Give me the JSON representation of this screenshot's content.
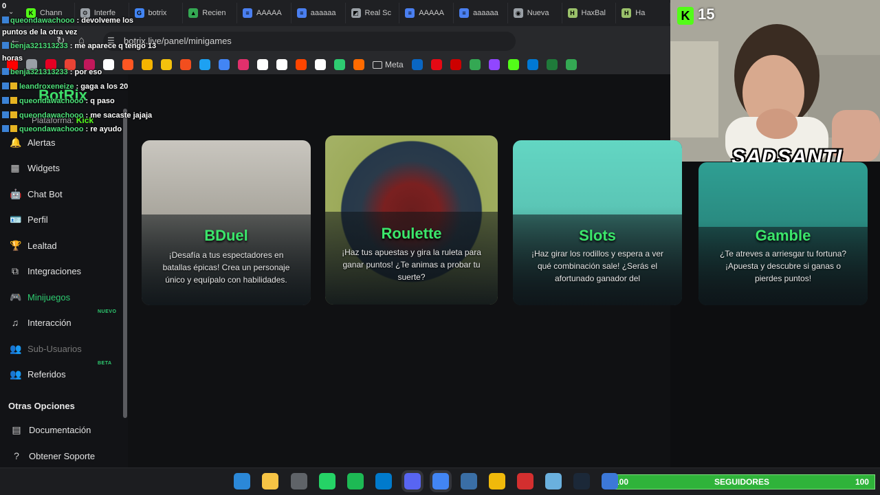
{
  "browser": {
    "tabs": [
      {
        "label": "Chann",
        "color": "#53fc18",
        "glyph": "K"
      },
      {
        "label": "Interfe",
        "color": "#9aa0a6",
        "glyph": "⚙"
      },
      {
        "label": "botrix",
        "color": "#4285f4",
        "glyph": "G"
      },
      {
        "label": "Recien",
        "color": "#34a853",
        "glyph": "▲"
      },
      {
        "label": "AAAAA",
        "color": "#4a7ff0",
        "glyph": "≡"
      },
      {
        "label": "aaaaaa",
        "color": "#4a7ff0",
        "glyph": "≡"
      },
      {
        "label": "Real Sc",
        "color": "#9aa0a6",
        "glyph": "◩"
      },
      {
        "label": "AAAAA",
        "color": "#4a7ff0",
        "glyph": "≡"
      },
      {
        "label": "aaaaaa",
        "color": "#4a7ff0",
        "glyph": "≡"
      },
      {
        "label": "Nueva",
        "color": "#9aa0a6",
        "glyph": "◉"
      },
      {
        "label": "HaxBal",
        "color": "#9ac16a",
        "glyph": "H"
      },
      {
        "label": "Ha",
        "color": "#9ac16a",
        "glyph": "H"
      }
    ],
    "url": "botrix.live/panel/minigames",
    "bookmark_folder": "Meta",
    "bookmark_colors": [
      "#ff0000",
      "#9aa0a6",
      "#e60023",
      "#ea4335",
      "#c2185b",
      "#ffffff",
      "#ff5722",
      "#f4b400",
      "#f4c20d",
      "#f24e1e",
      "#1da1f2",
      "#4285f4",
      "#e1306c",
      "#ffffff",
      "#ffffff",
      "#ff4500",
      "#ffffff",
      "#2ecc71",
      "#ff6b00"
    ],
    "bookmark_colors_after": [
      "#0a66c2",
      "#e50914",
      "#cc0000",
      "#34a853",
      "#9146ff",
      "#53fc18",
      "#0078d4",
      "#1f7a3a",
      "#34a853"
    ]
  },
  "sidebar": {
    "brand": "BotRix",
    "platform_label": "Plataforma:",
    "platform_value": "Kick",
    "items": [
      {
        "label": "Alertas",
        "icon": "bell-icon",
        "glyph": "🔔"
      },
      {
        "label": "Widgets",
        "icon": "grid-icon",
        "glyph": "▦"
      },
      {
        "label": "Chat Bot",
        "icon": "robot-icon",
        "glyph": "🤖"
      },
      {
        "label": "Perfil",
        "icon": "id-card-icon",
        "glyph": "🪪"
      },
      {
        "label": "Lealtad",
        "icon": "trophy-icon",
        "glyph": "🏆"
      },
      {
        "label": "Integraciones",
        "icon": "puzzle-icon",
        "glyph": "⧉"
      },
      {
        "label": "Minijuegos",
        "icon": "gamepad-icon",
        "glyph": "🎮"
      },
      {
        "label": "Interacción",
        "icon": "music-note-icon",
        "glyph": "♫",
        "badge": "NUEVO"
      },
      {
        "label": "Sub-Usuarios",
        "icon": "users-icon",
        "glyph": "👥"
      },
      {
        "label": "Referidos",
        "icon": "user-group-icon",
        "glyph": "👥",
        "badge": "BETA"
      }
    ],
    "section_title": "Otras Opciones",
    "extra": [
      {
        "label": "Documentación",
        "icon": "book-icon",
        "glyph": "▤"
      },
      {
        "label": "Obtener Soporte",
        "icon": "support-icon",
        "glyph": "?"
      }
    ]
  },
  "minigames": [
    {
      "title": "BDuel",
      "desc": "¡Desafía a tus espectadores en batallas épicas! Crea un personaje único y equípalo con habilidades."
    },
    {
      "title": "Roulette",
      "desc": "¡Haz tus apuestas y gira la ruleta para ganar puntos! ¿Te animas a probar tu suerte?"
    },
    {
      "title": "Slots",
      "desc": "¡Haz girar los rodillos y espera a ver qué combinación sale! ¿Serás el afortunado ganador del"
    },
    {
      "title": "Gamble",
      "desc": "¿Te atreves a arriesgar tu fortuna? ¡Apuesta y descubre si ganas o pierdes puntos!"
    }
  ],
  "chat": [
    {
      "user": "queondawachooo",
      "msg": ": devolveme los"
    },
    {
      "user": "",
      "msg": "puntos de la otra vez"
    },
    {
      "user": "benja321313233",
      "msg": ": me aparece q tengo 13"
    },
    {
      "user": "",
      "msg": "horas"
    },
    {
      "user": "benja321313233",
      "msg": ": por eso"
    },
    {
      "user": "leandroxeneize",
      "msg": ": gaga a los 20"
    },
    {
      "user": "queondawachooo",
      "msg": ": q paso"
    },
    {
      "user": "queondawachooo",
      "msg": ": me sacaste jajaja"
    },
    {
      "user": "queondawachooo",
      "msg": ": re ayudo"
    }
  ],
  "corner_number": "0",
  "stream": {
    "kick_glyph": "K",
    "viewer_count": "15",
    "streamer_name": "SADSANTI"
  },
  "follower_goal": {
    "current": "100",
    "label": "SEGUIDORES",
    "target": "100"
  },
  "taskbar_icons": [
    {
      "name": "windows-start-icon",
      "color": "#2b88d8"
    },
    {
      "name": "file-explorer-icon",
      "color": "#f6c445"
    },
    {
      "name": "calendar-icon",
      "color": "#5f6368"
    },
    {
      "name": "whatsapp-icon",
      "color": "#25d366"
    },
    {
      "name": "spotify-icon",
      "color": "#1db954"
    },
    {
      "name": "vscode-icon",
      "color": "#007acc"
    },
    {
      "name": "discord-icon",
      "color": "#5865f2"
    },
    {
      "name": "chrome-icon",
      "color": "#4285f4"
    },
    {
      "name": "settings-icon",
      "color": "#3a6ea5"
    },
    {
      "name": "binance-icon",
      "color": "#f0b90b"
    },
    {
      "name": "sp-app-icon",
      "color": "#d32f2f"
    },
    {
      "name": "notepad-icon",
      "color": "#6ab0de"
    },
    {
      "name": "steam-icon",
      "color": "#1b2838"
    },
    {
      "name": "app-icon",
      "color": "#3c78d8"
    }
  ]
}
